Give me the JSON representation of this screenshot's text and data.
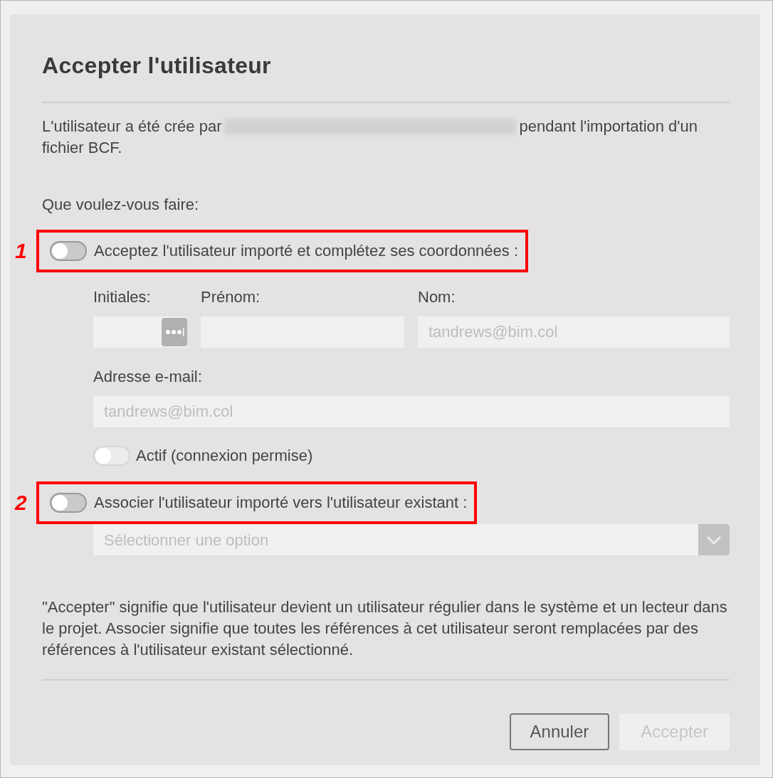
{
  "dialog": {
    "title": "Accepter l'utilisateur",
    "intro": {
      "before": "L'utilisateur a été crée par",
      "after": "pendant l'importation d'un fichier BCF."
    },
    "question": "Que voulez-vous faire:",
    "options": [
      {
        "marker": "1",
        "label": "Acceptez l'utilisateur importé et complétez ses coordonnées :",
        "on": false
      },
      {
        "marker": "2",
        "label": "Associer l'utilisateur importé vers l'utilisateur existant :",
        "on": false
      }
    ],
    "fields": [
      {
        "label": "Initiales:"
      },
      {
        "label": "Prénom:"
      },
      {
        "label": "Nom:",
        "placeholder": "tandrews@bim.col"
      }
    ],
    "email": {
      "label": "Adresse e-mail:",
      "placeholder": "tandrews@bim.col"
    },
    "active": {
      "label": "Actif (connexion permise)",
      "on": false,
      "disabled": true
    },
    "select": {
      "placeholder": "Sélectionner une option"
    },
    "note": "\"Accepter\" signifie que l'utilisateur devient un utilisateur régulier dans le système et un lecteur dans le projet. Associer signifie que toutes les références à cet utilisateur seront remplacées par des références à l'utilisateur existant sélectionné.",
    "buttons": [
      {
        "label": "Annuler",
        "disabled": false
      },
      {
        "label": "Accepter",
        "disabled": true
      }
    ]
  }
}
